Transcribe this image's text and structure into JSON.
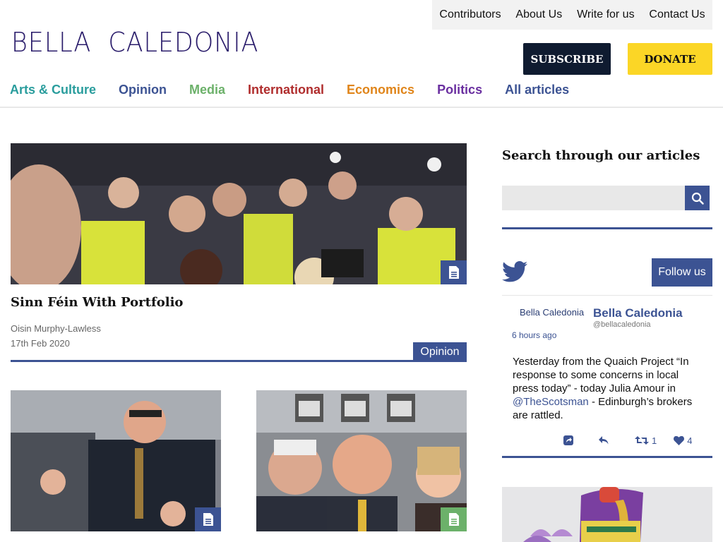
{
  "header": {
    "top_links": [
      "Contributors",
      "About Us",
      "Write for us",
      "Contact Us"
    ],
    "logo": "BELLA  CALEDONIA",
    "subscribe_label": "SUBSCRIBE",
    "donate_label": "DONATE",
    "categories": [
      {
        "label": "Arts & Culture",
        "color": "#2a9d9d"
      },
      {
        "label": "Opinion",
        "color": "#3c5393"
      },
      {
        "label": "Media",
        "color": "#6cb16a"
      },
      {
        "label": "International",
        "color": "#b02d2d"
      },
      {
        "label": "Economics",
        "color": "#e0851a"
      },
      {
        "label": "Politics",
        "color": "#6a2fa0"
      },
      {
        "label": "All articles",
        "color": "#3c5393"
      }
    ]
  },
  "featured": {
    "title": "Sinn Féin With Portfolio",
    "author": "Oisin Murphy-Lawless",
    "date": "17th Feb 2020",
    "category": "Opinion"
  },
  "sidebar": {
    "search_title": "Search through our articles",
    "search_placeholder": "",
    "follow_label": "Follow us",
    "tweet": {
      "name_small": "Bella Caledonia",
      "name": "Bella Caledonia",
      "handle": "@bellacaledonia",
      "time": "6 hours ago",
      "text_part1": "Yesterday from the Quaich Project “In response to some concerns in local press today” - today Julia Amour in ",
      "link": "@TheScotsman",
      "text_part2": " - Edinburgh’s brokers are rattled.",
      "retweets": "1",
      "likes": "4"
    }
  },
  "colors": {
    "accent": "#3c5393",
    "subscribe_bg": "#0f1b30",
    "donate_bg": "#fbd626",
    "logo": "#2a1c6b"
  }
}
